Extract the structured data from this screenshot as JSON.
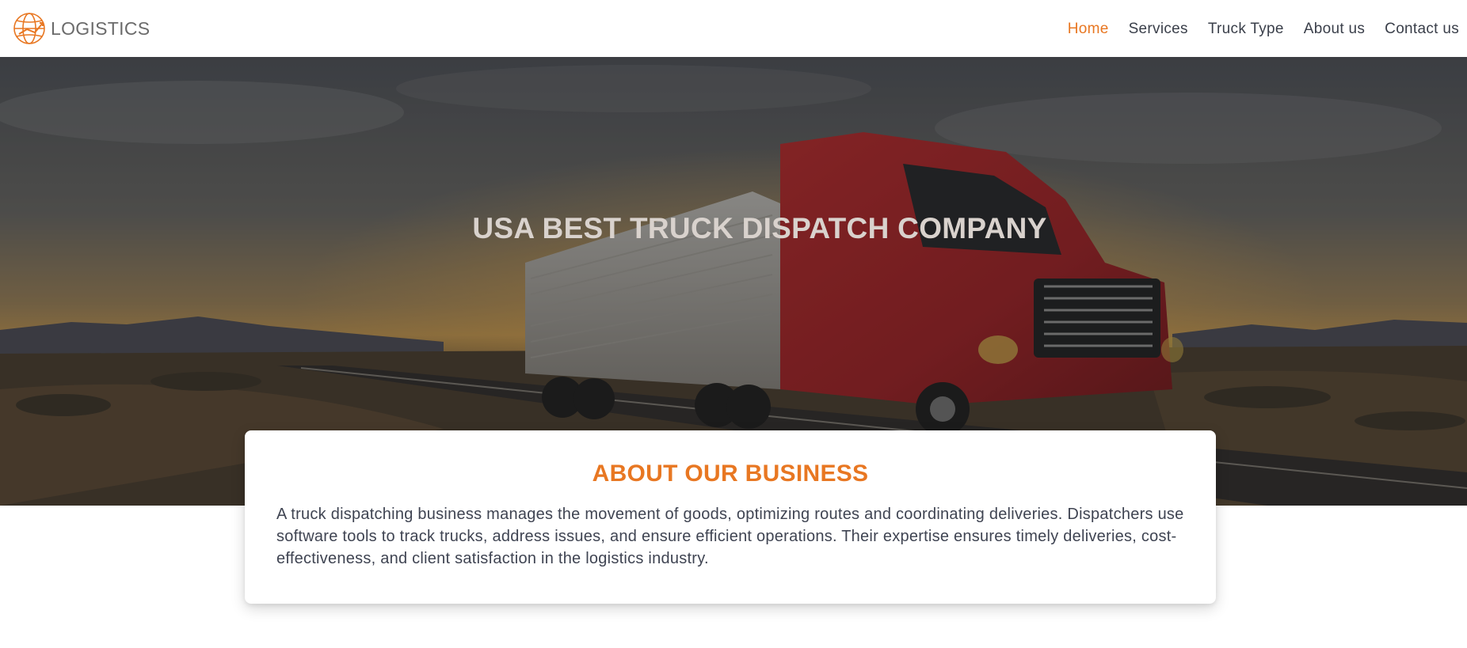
{
  "header": {
    "brand_name": "LOGISTICS",
    "brand_icon": "globe-truck-icon",
    "nav": [
      {
        "label": "Home",
        "active": true
      },
      {
        "label": "Services",
        "active": false
      },
      {
        "label": "Truck Type",
        "active": false
      },
      {
        "label": "About us",
        "active": false
      },
      {
        "label": "Contact us",
        "active": false
      }
    ]
  },
  "hero": {
    "title": "USA BEST TRUCK DISPATCH COMPANY",
    "background": "red semi-truck with reefer trailer on desert highway at sunset"
  },
  "about": {
    "title": "ABOUT OUR BUSINESS",
    "text": "A truck dispatching business manages the movement of goods, optimizing routes and coordinating deliveries. Dispatchers use software tools to track trucks, address issues, and ensure efficient operations. Their expertise ensures timely deliveries, cost-effectiveness, and client satisfaction in the logistics industry."
  },
  "colors": {
    "accent": "#e87722",
    "text": "#3a3f4a",
    "hero_title": "#d9d2cd"
  }
}
